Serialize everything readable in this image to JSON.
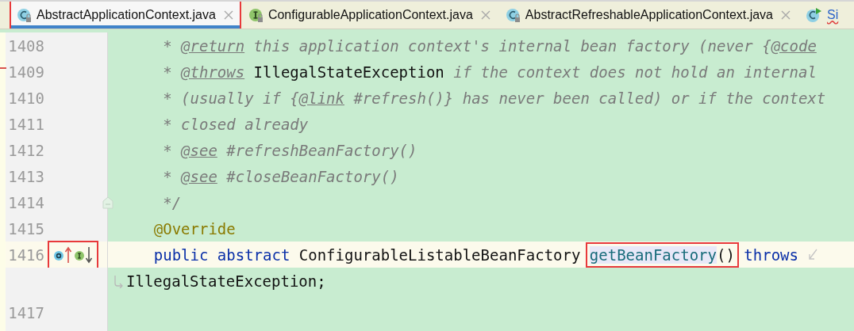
{
  "tabs": [
    {
      "label": "AbstractApplicationContext.java",
      "kind": "class",
      "selected": true,
      "marked": true,
      "error": false
    },
    {
      "label": "ConfigurableApplicationContext.java",
      "kind": "interface",
      "selected": false,
      "marked": false,
      "error": false
    },
    {
      "label": "AbstractRefreshableApplicationContext.java",
      "kind": "class",
      "selected": false,
      "marked": false,
      "error": false
    },
    {
      "label": "Si",
      "kind": "runnable",
      "selected": false,
      "marked": false,
      "error": true
    }
  ],
  "editor": {
    "lines": [
      {
        "kind": "code",
        "number": "1408",
        "current": false,
        "changed": false,
        "fold": false,
        "segments": [
          {
            "kind": "comment",
            "text": "     * "
          },
          {
            "kind": "doc-tag",
            "text": "@return"
          },
          {
            "kind": "comment",
            "text": " this application context's internal bean factory (never {"
          },
          {
            "kind": "doc-tag",
            "text": "@code"
          }
        ]
      },
      {
        "kind": "code",
        "number": "1409",
        "current": false,
        "changed": true,
        "fold": false,
        "segments": [
          {
            "kind": "comment",
            "text": "     * "
          },
          {
            "kind": "doc-tag",
            "text": "@throws"
          },
          {
            "kind": "doc-ref",
            "text": " IllegalStateException"
          },
          {
            "kind": "comment",
            "text": " if the context does not hold an internal"
          }
        ]
      },
      {
        "kind": "code",
        "number": "1410",
        "current": false,
        "changed": false,
        "fold": false,
        "segments": [
          {
            "kind": "comment",
            "text": "     * (usually if {"
          },
          {
            "kind": "doc-tag",
            "text": "@link"
          },
          {
            "kind": "comment",
            "text": " #refresh()} has never been called) or if the context"
          }
        ]
      },
      {
        "kind": "code",
        "number": "1411",
        "current": false,
        "changed": false,
        "fold": false,
        "segments": [
          {
            "kind": "comment",
            "text": "     * closed already"
          }
        ]
      },
      {
        "kind": "code",
        "number": "1412",
        "current": false,
        "changed": false,
        "fold": false,
        "segments": [
          {
            "kind": "comment",
            "text": "     * "
          },
          {
            "kind": "doc-tag",
            "text": "@see"
          },
          {
            "kind": "comment",
            "text": " #refreshBeanFactory()"
          }
        ]
      },
      {
        "kind": "code",
        "number": "1413",
        "current": false,
        "changed": false,
        "fold": false,
        "segments": [
          {
            "kind": "comment",
            "text": "     * "
          },
          {
            "kind": "doc-tag",
            "text": "@see"
          },
          {
            "kind": "comment",
            "text": " #closeBeanFactory()"
          }
        ]
      },
      {
        "kind": "code",
        "number": "1414",
        "current": false,
        "changed": false,
        "fold": true,
        "segments": [
          {
            "kind": "comment",
            "text": "     */"
          }
        ]
      },
      {
        "kind": "code",
        "number": "1415",
        "current": false,
        "changed": false,
        "fold": false,
        "segments": [
          {
            "kind": "annotation",
            "text": "    @Override"
          }
        ]
      },
      {
        "kind": "code",
        "number": "1416",
        "current": true,
        "changed": false,
        "fold": false,
        "gutter_marked": true,
        "gutter_icons": [
          {
            "kind": "overrides"
          },
          {
            "kind": "implemented"
          }
        ],
        "wraps": true,
        "segments": [
          {
            "kind": "keyword",
            "text": "    public abstract "
          },
          {
            "kind": "plain",
            "text": "ConfigurableListableBeanFactory "
          },
          {
            "kind": "call",
            "name": "getBeanFactory",
            "args": "()",
            "marked": true
          },
          {
            "kind": "keyword",
            "text": " throws"
          }
        ]
      },
      {
        "kind": "continuation",
        "current": false,
        "changed": false,
        "fold": false,
        "segments": [
          {
            "kind": "plain",
            "text": "IllegalStateException;"
          }
        ]
      },
      {
        "kind": "code",
        "number": "1417",
        "current": false,
        "changed": false,
        "fold": false
      }
    ]
  }
}
